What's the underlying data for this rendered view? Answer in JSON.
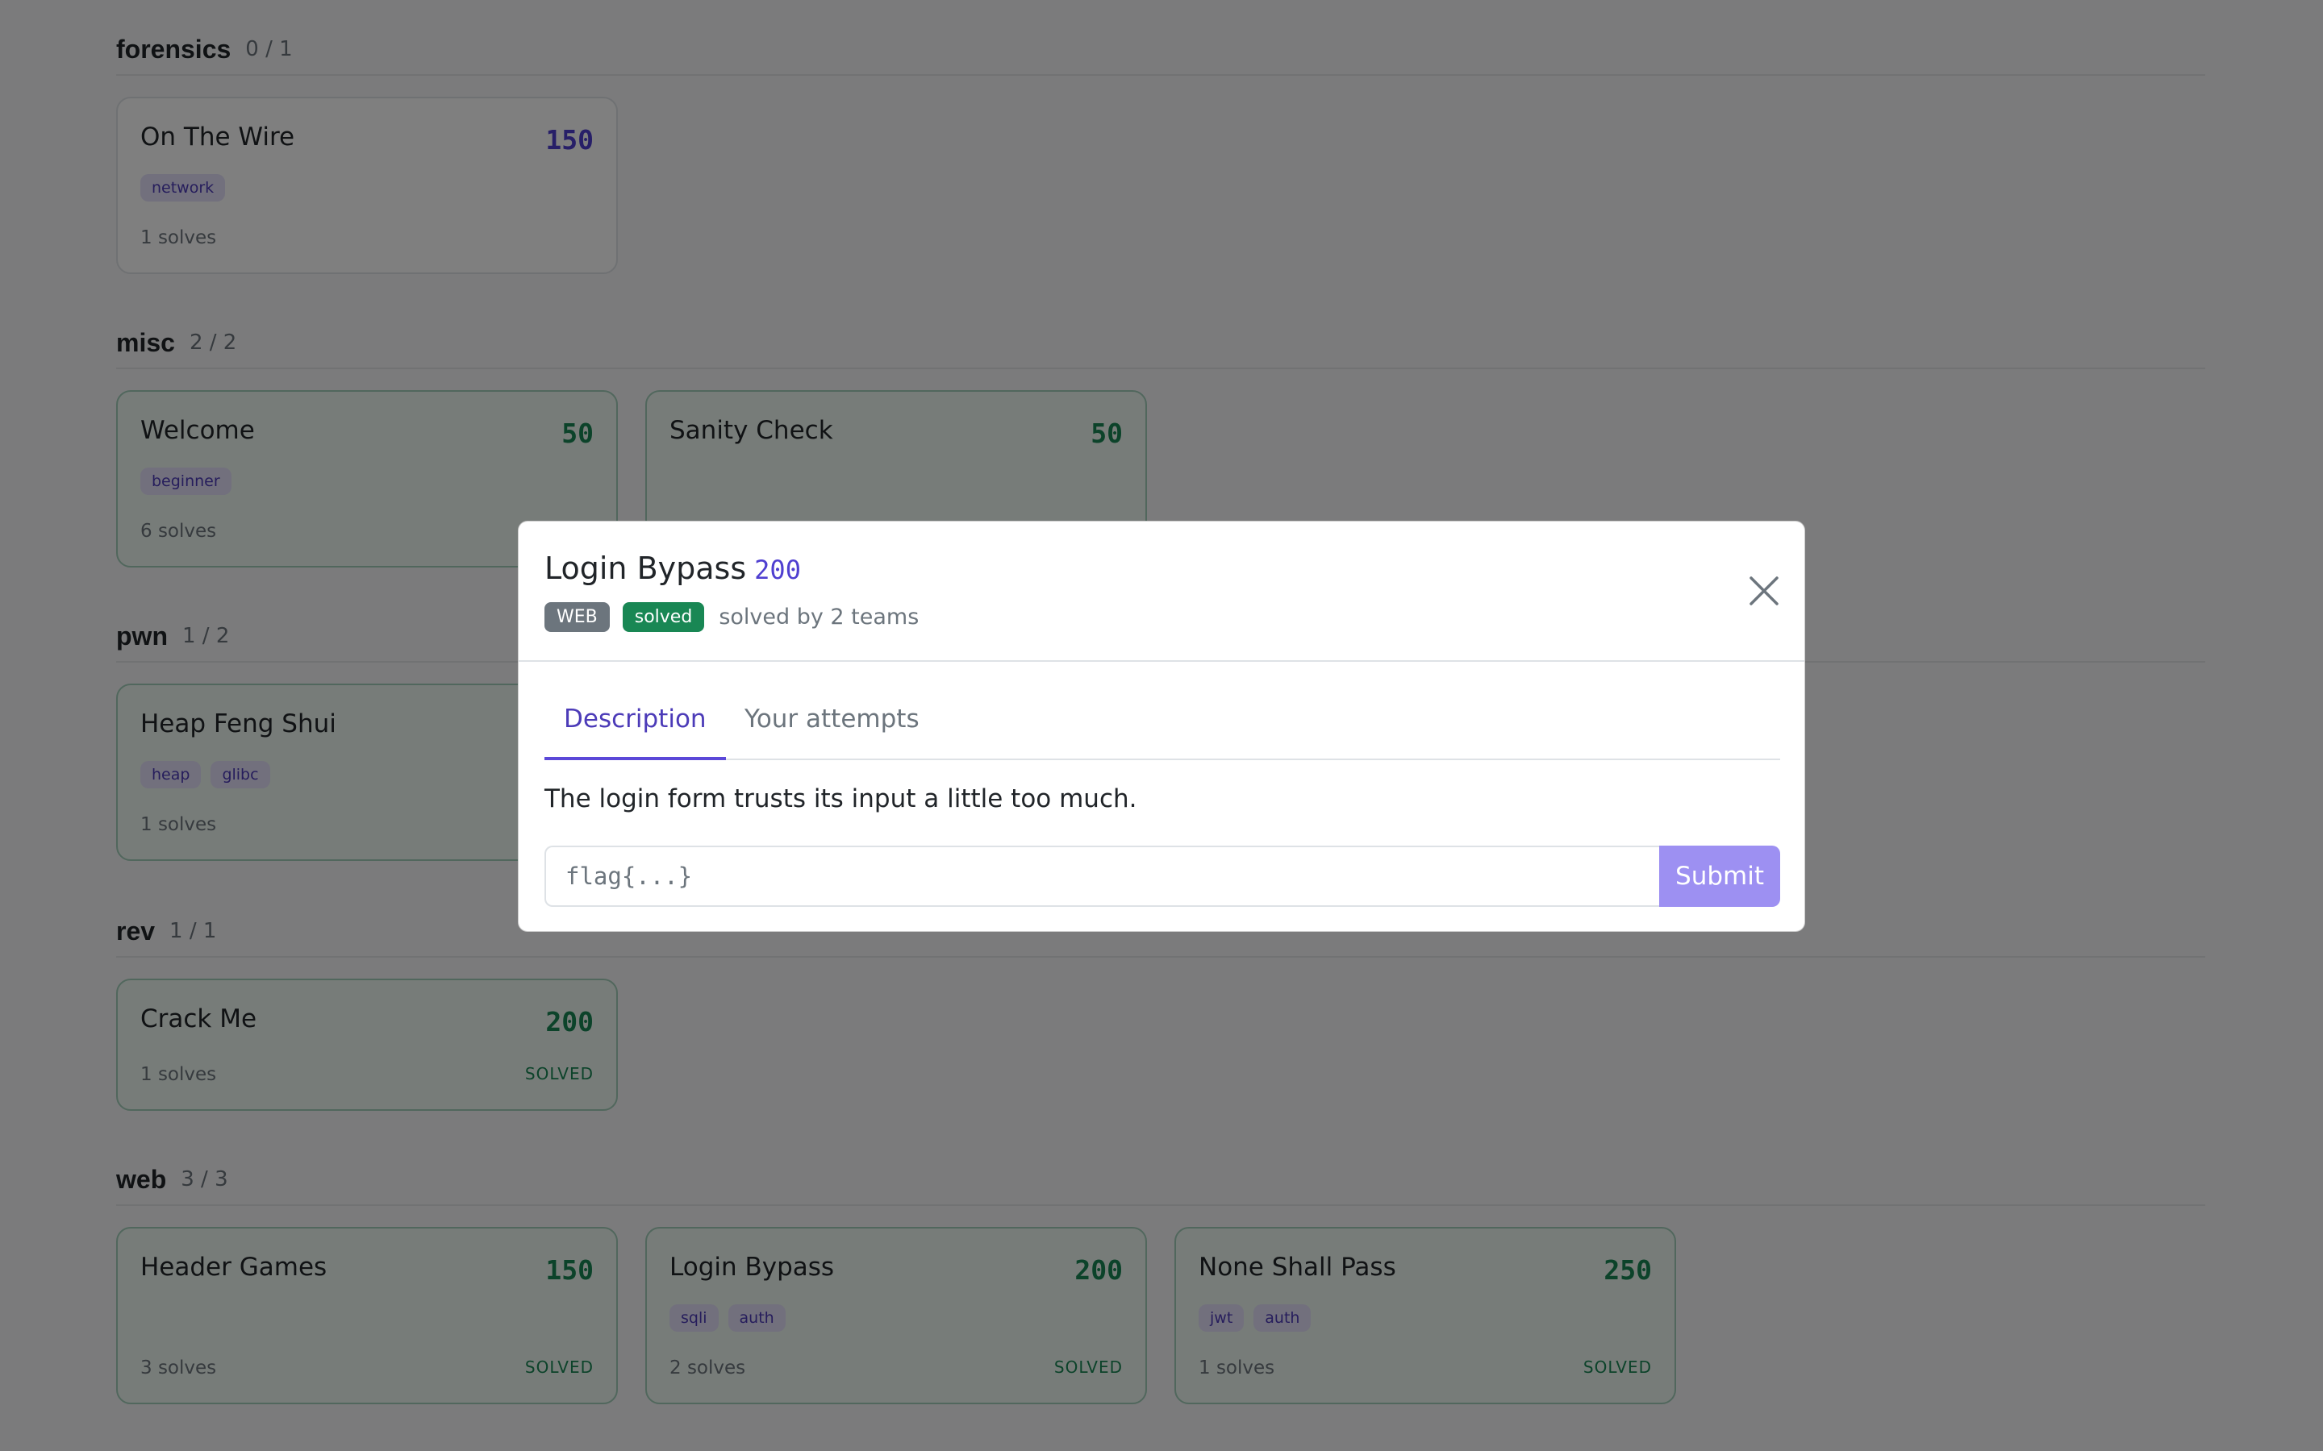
{
  "sections": [
    {
      "title": "forensics",
      "count": "0 / 1",
      "cards": [
        {
          "title": "On The Wire",
          "points": "150",
          "tags": [
            "network"
          ],
          "solves": "1 solves",
          "solved": false
        }
      ]
    },
    {
      "title": "misc",
      "count": "2 / 2",
      "cards": [
        {
          "title": "Welcome",
          "points": "50",
          "tags": [
            "beginner"
          ],
          "solves": "6 solves",
          "solved": true
        },
        {
          "title": "Sanity Check",
          "points": "50",
          "tags": [],
          "solves": "",
          "solved": true
        }
      ]
    },
    {
      "title": "pwn",
      "count": "1 / 2",
      "cards": [
        {
          "title": "Heap Feng Shui",
          "points": "",
          "tags": [
            "heap",
            "glibc"
          ],
          "solves": "1 solves",
          "solved": true
        }
      ]
    },
    {
      "title": "rev",
      "count": "1 / 1",
      "cards": [
        {
          "title": "Crack Me",
          "points": "200",
          "tags": [],
          "solves": "1 solves",
          "solved": true,
          "solved_label": "SOLVED"
        }
      ]
    },
    {
      "title": "web",
      "count": "3 / 3",
      "cards": [
        {
          "title": "Header Games",
          "points": "150",
          "tags": [],
          "solves": "3 solves",
          "solved": true,
          "solved_label": "SOLVED"
        },
        {
          "title": "Login Bypass",
          "points": "200",
          "tags": [
            "sqli",
            "auth"
          ],
          "solves": "2 solves",
          "solved": true,
          "solved_label": "SOLVED"
        },
        {
          "title": "None Shall Pass",
          "points": "250",
          "tags": [
            "jwt",
            "auth"
          ],
          "solves": "1 solves",
          "solved": true,
          "solved_label": "SOLVED"
        }
      ]
    }
  ],
  "modal": {
    "title": "Login Bypass",
    "points": "200",
    "category_badge": "WEB",
    "solved_badge": "solved",
    "solved_by": "solved by 2 teams",
    "tabs": [
      "Description",
      "Your attempts"
    ],
    "active_tab": "Description",
    "description": "The login form trusts its input a little too much.",
    "flag_placeholder": "flag{...}",
    "submit_label": "Submit",
    "close_icon": "close-icon"
  },
  "colors": {
    "accent": "#5b48d8",
    "solved": "#198754",
    "overlay": "rgba(0,0,0,0.5)"
  }
}
